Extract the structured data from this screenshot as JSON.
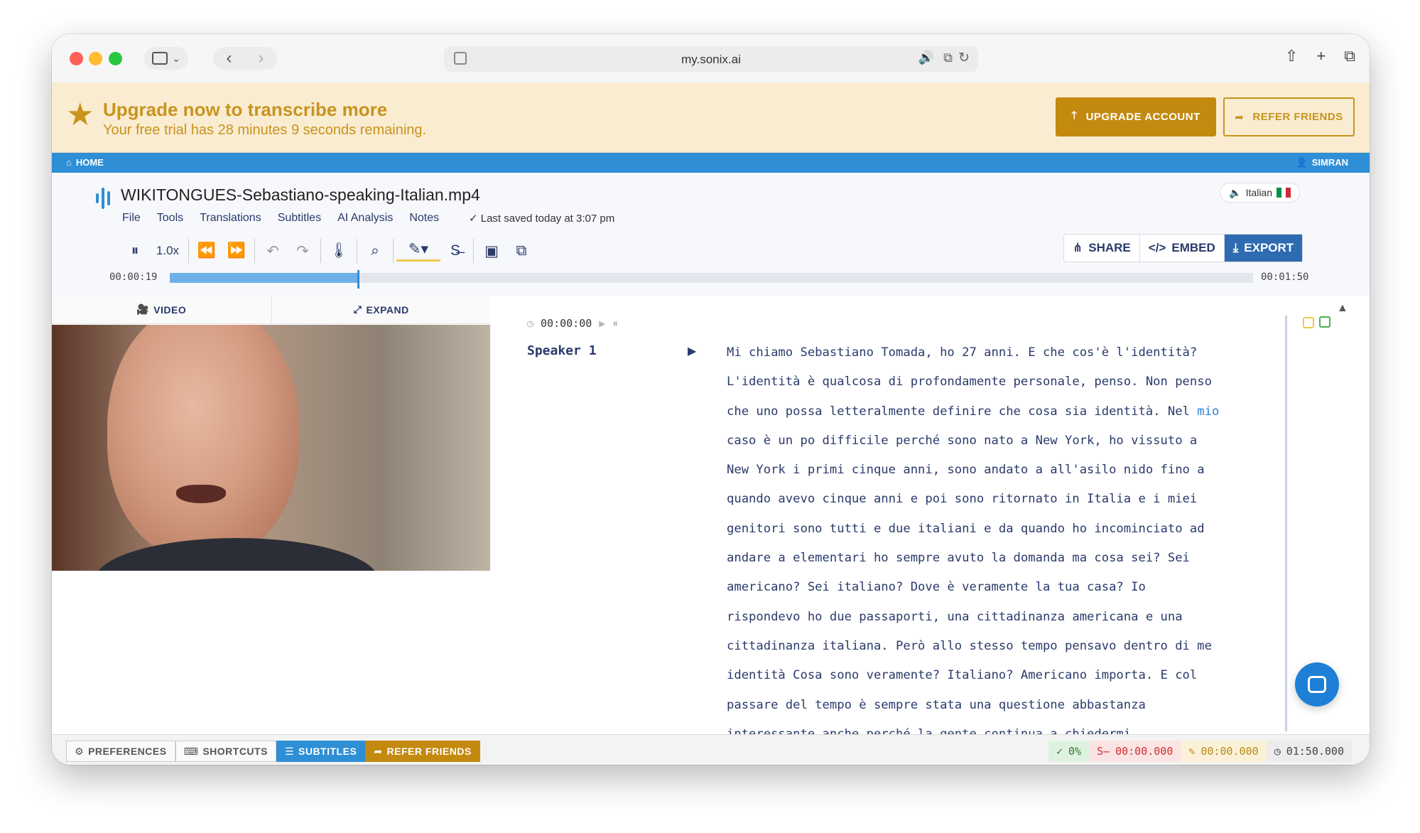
{
  "browser": {
    "url": "my.sonix.ai"
  },
  "banner": {
    "title": "Upgrade now to transcribe more",
    "subtitle": "Your free trial has 28 minutes 9 seconds remaining.",
    "upgrade_label": "UPGRADE ACCOUNT",
    "refer_label": "REFER FRIENDS"
  },
  "nav": {
    "home_label": "HOME",
    "user_label": "SIMRAN"
  },
  "file": {
    "name": "WIKITONGUES-Sebastiano-speaking-Italian.mp4",
    "language": "Italian",
    "saved_status": "Last saved today at 3:07 pm",
    "menus": [
      "File",
      "Tools",
      "Translations",
      "Subtitles",
      "AI Analysis",
      "Notes"
    ]
  },
  "toolbar": {
    "speed": "1.0x"
  },
  "actions": {
    "share": "SHARE",
    "embed": "EMBED",
    "export": "EXPORT"
  },
  "timeline": {
    "current": "00:00:19",
    "total": "00:01:50",
    "progress": 0.173
  },
  "video_tabs": {
    "video": "VIDEO",
    "expand": "EXPAND"
  },
  "transcript": {
    "timestamp": "00:00:00",
    "speaker": "Speaker 1",
    "lines": [
      "Mi chiamo Sebastiano Tomada, ho 27 anni. E che cos'è l'identità?",
      "L'identità è qualcosa di profondamente personale, penso. Non penso",
      "che uno possa letteralmente definire che cosa sia identità. Nel",
      "caso è un po difficile perché sono nato a New York, ho vissuto a",
      "New York i primi cinque anni, sono andato a all'asilo nido fino a",
      "quando avevo cinque anni e poi sono ritornato in Italia e i miei",
      "genitori sono tutti e due italiani e da quando ho incominciato ad",
      "andare a elementari ho sempre avuto la domanda ma cosa sei? Sei",
      "americano? Sei italiano? Dove è veramente la tua casa? Io",
      "rispondevo ho due passaporti, una cittadinanza americana e una",
      "cittadinanza italiana. Però allo stesso tempo pensavo dentro di me",
      "identità Cosa sono veramente? Italiano? Americano importa. E col",
      "passare del tempo è sempre stata una questione abbastanza",
      "interessante anche perché la gente continua a chiedermi"
    ],
    "highlight_word": "mio"
  },
  "bottom_left": {
    "preferences": "PREFERENCES",
    "shortcuts": "SHORTCUTS",
    "subtitles": "SUBTITLES",
    "refer": "REFER FRIENDS"
  },
  "bottom_right": {
    "percent": "0%",
    "strike_time": "00:00.000",
    "edit_time": "00:00.000",
    "duration": "01:50.000"
  },
  "colors": {
    "accent": "#2e8fd6",
    "gold": "#c4890f",
    "text": "#2a3a6b"
  }
}
